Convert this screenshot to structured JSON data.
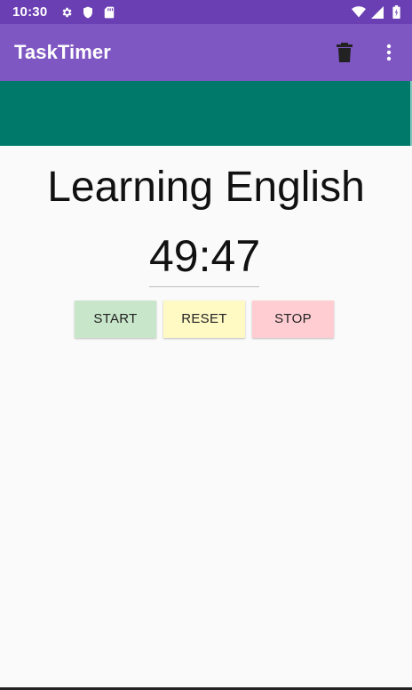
{
  "status_bar": {
    "time": "10:30",
    "icons": [
      "gear-icon",
      "shield-icon",
      "sd-card-icon",
      "wifi-icon",
      "signal-icon",
      "battery-icon"
    ]
  },
  "app_bar": {
    "title": "TaskTimer",
    "actions": [
      "trash-icon",
      "overflow-menu-icon"
    ]
  },
  "task": {
    "name": "Learning English",
    "timer": "49:47"
  },
  "buttons": {
    "start": "START",
    "reset": "RESET",
    "stop": "STOP"
  },
  "colors": {
    "status_bar": "#6a3fb3",
    "app_bar": "#7e57c2",
    "banner": "#00796b",
    "start": "#c8e6c9",
    "reset": "#fff9c4",
    "stop": "#ffcdd2"
  }
}
